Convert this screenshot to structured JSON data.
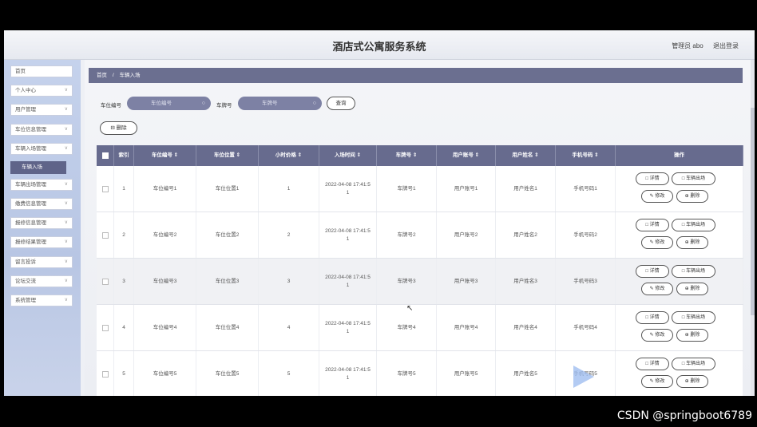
{
  "header": {
    "title": "酒店式公寓服务系统",
    "user_label": "管理员 abo",
    "logout_label": "退出登录"
  },
  "sidebar": {
    "items": [
      {
        "label": "首页",
        "chevron": false
      },
      {
        "label": "个人中心",
        "chevron": true
      },
      {
        "label": "用户管理",
        "chevron": true
      },
      {
        "label": "车位信息管理",
        "chevron": true
      },
      {
        "label": "车辆入场管理",
        "chevron": true
      },
      {
        "label": "车辆出场管理",
        "chevron": true
      },
      {
        "label": "缴费信息管理",
        "chevron": true
      },
      {
        "label": "报修信息管理",
        "chevron": true
      },
      {
        "label": "报修结果管理",
        "chevron": true
      },
      {
        "label": "留言投诉",
        "chevron": true
      },
      {
        "label": "论坛交流",
        "chevron": true
      },
      {
        "label": "系统管理",
        "chevron": true
      }
    ],
    "active_sub": "车辆入场"
  },
  "breadcrumb": {
    "home": "首页",
    "sep": "/",
    "current": "车辆入场"
  },
  "search": {
    "field1_label": "车位编号",
    "field1_placeholder": "车位编号",
    "field2_label": "车牌号",
    "field2_placeholder": "车牌号",
    "query_button": "查询",
    "delete_button": "删除"
  },
  "table": {
    "columns": [
      "索引",
      "车位编号",
      "车位位置",
      "小时价格",
      "入场时间",
      "车牌号",
      "用户账号",
      "用户姓名",
      "手机号码",
      "操作"
    ],
    "rows": [
      {
        "index": "1",
        "spot_no": "车位编号1",
        "spot_loc": "车位位置1",
        "price": "1",
        "time_a": "2022-04-08 17:41:5",
        "time_b": "1",
        "plate": "车牌号1",
        "account": "用户账号1",
        "name": "用户姓名1",
        "phone": "手机号码1"
      },
      {
        "index": "2",
        "spot_no": "车位编号2",
        "spot_loc": "车位位置2",
        "price": "2",
        "time_a": "2022-04-08 17:41:5",
        "time_b": "1",
        "plate": "车牌号2",
        "account": "用户账号2",
        "name": "用户姓名2",
        "phone": "手机号码2"
      },
      {
        "index": "3",
        "spot_no": "车位编号3",
        "spot_loc": "车位位置3",
        "price": "3",
        "time_a": "2022-04-08 17:41:5",
        "time_b": "1",
        "plate": "车牌号3",
        "account": "用户账号3",
        "name": "用户姓名3",
        "phone": "手机号码3"
      },
      {
        "index": "4",
        "spot_no": "车位编号4",
        "spot_loc": "车位位置4",
        "price": "4",
        "time_a": "2022-04-08 17:41:5",
        "time_b": "1",
        "plate": "车牌号4",
        "account": "用户账号4",
        "name": "用户姓名4",
        "phone": "手机号码4"
      },
      {
        "index": "5",
        "spot_no": "车位编号5",
        "spot_loc": "车位位置5",
        "price": "5",
        "time_a": "2022-04-08 17:41:5",
        "time_b": "1",
        "plate": "车牌号5",
        "account": "用户账号5",
        "name": "用户姓名5",
        "phone": "手机号码5"
      }
    ],
    "ops": {
      "detail": "详情",
      "exit": "车辆出场",
      "edit": "修改",
      "delete": "删除"
    }
  },
  "watermark": "CSDN @springboot6789"
}
